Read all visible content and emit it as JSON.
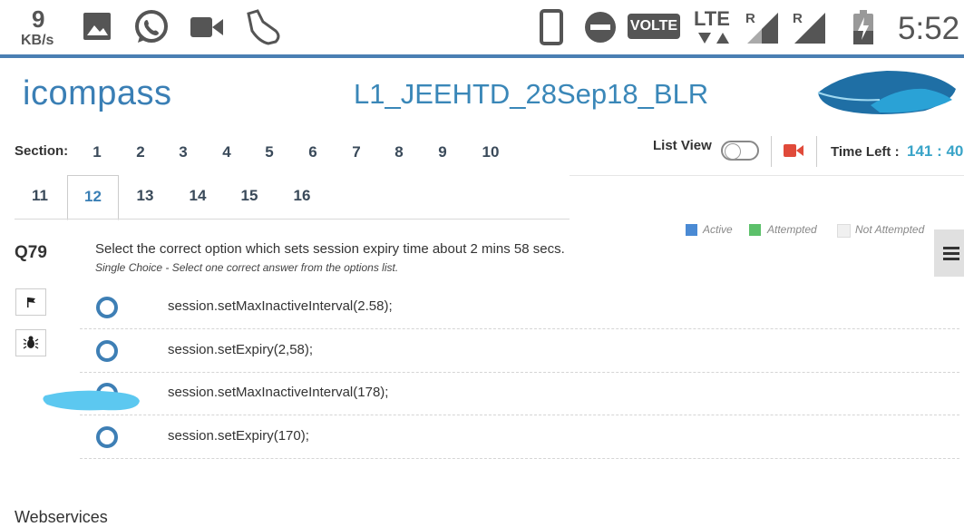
{
  "status_bar": {
    "net_speed_value": "9",
    "net_speed_unit": "KB/s",
    "volte": "VOLTE",
    "lte": "LTE",
    "roaming_1": "R",
    "roaming_2": "R",
    "time": "5:52"
  },
  "header": {
    "logo_text": "icompass",
    "test_title": "L1_JEEHTD_28Sep18_BLR"
  },
  "sections": {
    "label": "Section:",
    "items": [
      "1",
      "2",
      "3",
      "4",
      "5",
      "6",
      "7",
      "8",
      "9",
      "10",
      "11",
      "12",
      "13",
      "14",
      "15",
      "16"
    ],
    "active": "12"
  },
  "controls": {
    "list_view_label": "List View",
    "list_view_on": false,
    "time_left_label": "Time Left :",
    "time_left_value": "141 : 40"
  },
  "legend": {
    "active": "Active",
    "attempted": "Attempted",
    "not_attempted": "Not Attempted",
    "colors": {
      "active": "#4a8ad4",
      "attempted": "#5cc06a",
      "not_attempted": "#f0f0f0"
    }
  },
  "question": {
    "number": "Q79",
    "text": "Select the correct option which sets session expiry time about 2 mins 58 secs.",
    "instruction": "Single Choice - Select one correct answer from the options list.",
    "options": [
      "session.setMaxInactiveInterval(2.58);",
      "session.setExpiry(2,58);",
      "session.setMaxInactiveInterval(178);",
      "session.setExpiry(170);"
    ]
  },
  "icons": {
    "flag": "flag-icon",
    "bug": "bug-icon",
    "menu": "hamburger-icon",
    "camera": "video-camera-icon"
  },
  "next_section_title": "Webservices"
}
